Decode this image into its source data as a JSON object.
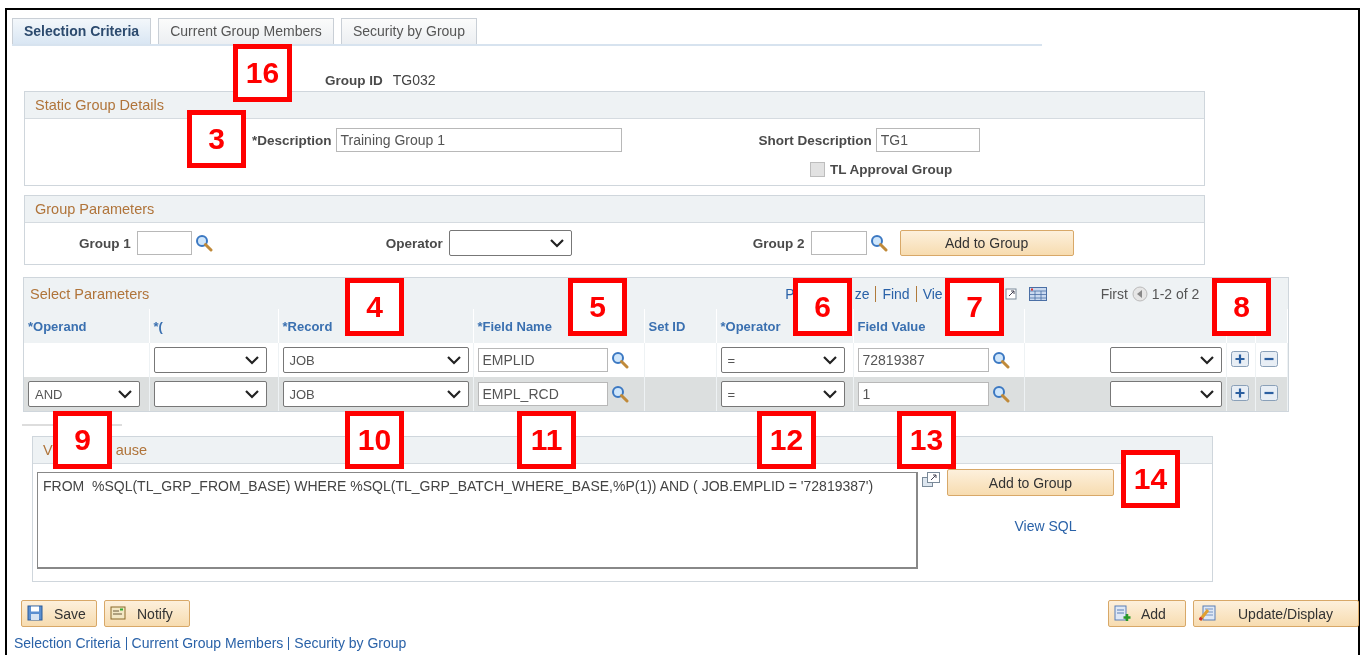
{
  "tabs": [
    {
      "label": "Selection Criteria",
      "selected": true
    },
    {
      "label": "Current Group Members",
      "selected": false
    },
    {
      "label": "Security by Group",
      "selected": false
    }
  ],
  "group_id": {
    "label": "Group ID",
    "value": "TG032"
  },
  "static_group_details": {
    "title": "Static Group Details",
    "description": {
      "label": "*Description",
      "value": "Training Group 1"
    },
    "short_description": {
      "label": "Short Description",
      "value": "TG1"
    },
    "tl_approval_group": {
      "label": "TL Approval Group",
      "checked": false,
      "disabled": true
    }
  },
  "group_parameters": {
    "title": "Group Parameters",
    "group_1": {
      "label": "Group 1"
    },
    "operator": {
      "label": "Operator"
    },
    "group_2": {
      "label": "Group 2"
    },
    "button": "Add to Group"
  },
  "select_parameters": {
    "title": "Select Parameters",
    "toolbar": [
      "P",
      "ze",
      "Find",
      "Vie"
    ],
    "pager": {
      "first": "First",
      "range": "1-2 of 2"
    },
    "columns": [
      "*Operand",
      "*(",
      "*Record",
      "*Field Name",
      "Set ID",
      "*Operator",
      "Field Value"
    ],
    "rows": [
      {
        "record": "JOB",
        "field_name": "EMPLID",
        "operator": "=",
        "field_value": "72819387"
      },
      {
        "operand": "AND",
        "record": "JOB",
        "field_name": "EMPL_RCD",
        "operator": "=",
        "field_value": "1"
      }
    ]
  },
  "where_clause": {
    "title_parts": [
      "V",
      "ause"
    ],
    "sql": "FROM  %SQL(TL_GRP_FROM_BASE) WHERE %SQL(TL_GRP_BATCH_WHERE_BASE,%P(1)) AND ( JOB.EMPLID = '72819387')",
    "button": "Add to Group",
    "link": "View SQL"
  },
  "footer": {
    "left_buttons": [
      {
        "kind": "save",
        "label": "Save"
      },
      {
        "kind": "notify",
        "label": "Notify"
      }
    ],
    "right_buttons": [
      {
        "kind": "add",
        "label": "Add"
      },
      {
        "kind": "update",
        "label": "Update/Display"
      }
    ],
    "links": [
      "Selection Criteria",
      "Current Group Members",
      "Security by Group"
    ]
  },
  "callouts": [
    "16",
    "3",
    "4",
    "5",
    "6",
    "7",
    "8",
    "9",
    "10",
    "11",
    "12",
    "13",
    "14"
  ]
}
